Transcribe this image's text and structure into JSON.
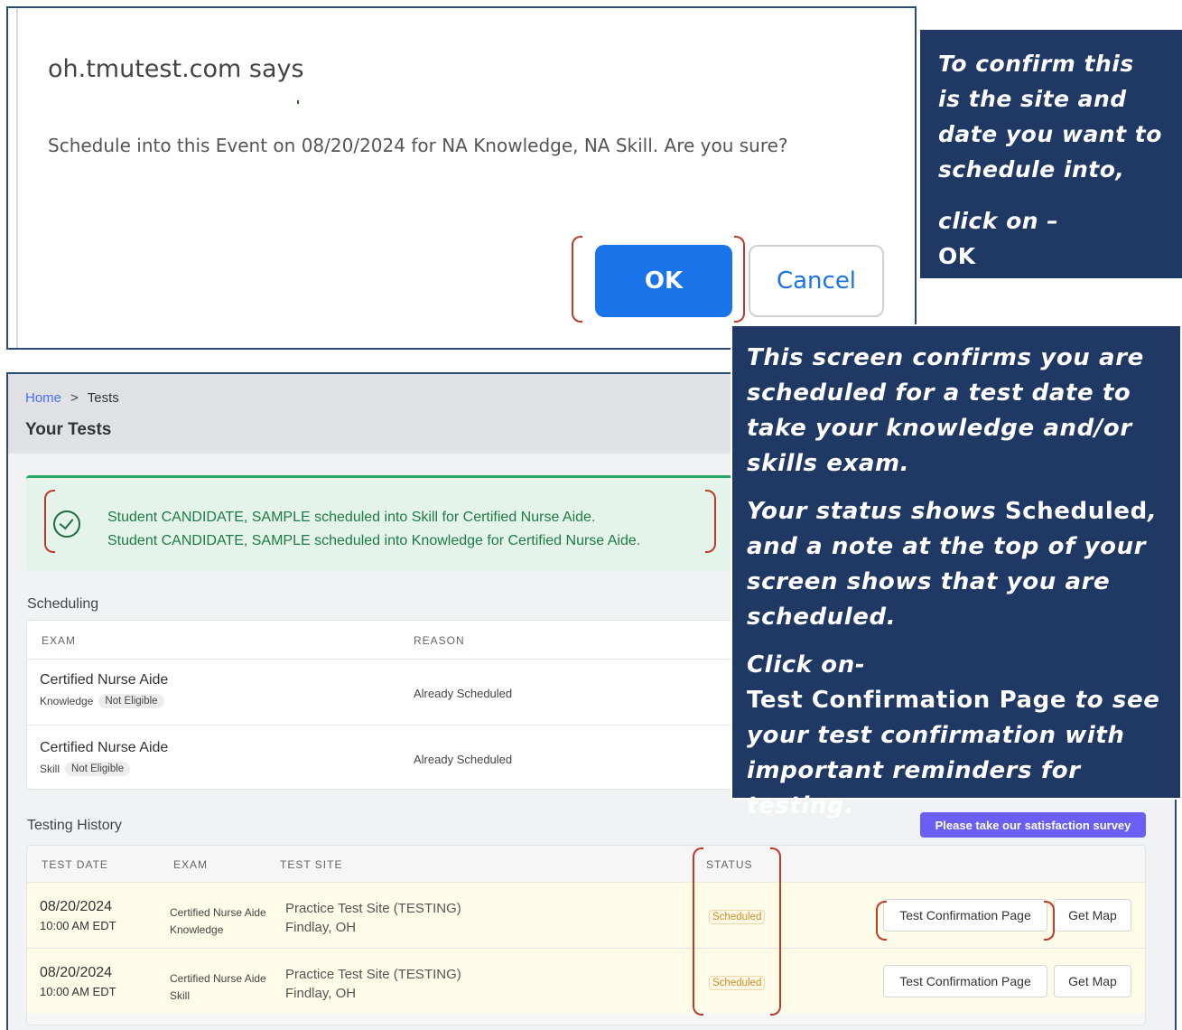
{
  "dialog": {
    "title": "oh.tmutest.com says",
    "message": "Schedule into this Event on 08/20/2024 for NA Knowledge, NA Skill.  Are you sure?",
    "ok_label": "OK",
    "cancel_label": "Cancel"
  },
  "callout_ok": {
    "text": "To confirm this is the site and date you want to schedule into,",
    "click_text": "click on –",
    "button_name": "OK"
  },
  "callout_page": {
    "para1": "This screen confirms you are scheduled for a test date to take your knowledge and/or skills exam.",
    "para2_a": "Your status shows ",
    "para2_strong": "Scheduled",
    "para2_b": ", and a note at the top of your screen shows that you are scheduled.",
    "para3_a": "Click on-",
    "para3_strong": "Test Confirmation Page",
    "para3_b": " to see your test confirmation with important reminders for testing."
  },
  "app": {
    "breadcrumb": {
      "home": "Home",
      "separator": ">",
      "current": "Tests"
    },
    "page_title": "Your Tests",
    "alert": {
      "icon": "check-circle-icon",
      "line1": "Student CANDIDATE, SAMPLE scheduled into Skill for Certified Nurse Aide.",
      "line2": "Student CANDIDATE, SAMPLE scheduled into Knowledge for Certified Nurse Aide."
    },
    "scheduling": {
      "label": "Scheduling",
      "columns": [
        "EXAM",
        "REASON"
      ],
      "rows": [
        {
          "exam": "Certified Nurse Aide",
          "type": "Knowledge",
          "eligibility": "Not Eligible",
          "reason": "Already Scheduled"
        },
        {
          "exam": "Certified Nurse Aide",
          "type": "Skill",
          "eligibility": "Not Eligible",
          "reason": "Already Scheduled"
        }
      ]
    },
    "history": {
      "label": "Testing History",
      "survey_button": "Please take our satisfaction survey",
      "columns": [
        "TEST DATE",
        "EXAM",
        "TEST SITE",
        "STATUS"
      ],
      "rows": [
        {
          "date": "08/20/2024",
          "time": "10:00 AM EDT",
          "exam": "Certified Nurse Aide",
          "type": "Knowledge",
          "site": "Practice Test Site (TESTING)",
          "city": "Findlay, OH",
          "status": "Scheduled",
          "confirm_label": "Test Confirmation Page",
          "map_label": "Get Map"
        },
        {
          "date": "08/20/2024",
          "time": "10:00 AM EDT",
          "exam": "Certified Nurse Aide",
          "type": "Skill",
          "site": "Practice Test Site (TESTING)",
          "city": "Findlay, OH",
          "status": "Scheduled",
          "confirm_label": "Test Confirmation Page",
          "map_label": "Get Map"
        }
      ]
    }
  },
  "colors": {
    "callout_bg": "#1f3864",
    "highlight": "#c0392b",
    "primary": "#1a73e8",
    "survey": "#6b5ef5",
    "success": "#1e7a46",
    "status": "#c8922a"
  }
}
